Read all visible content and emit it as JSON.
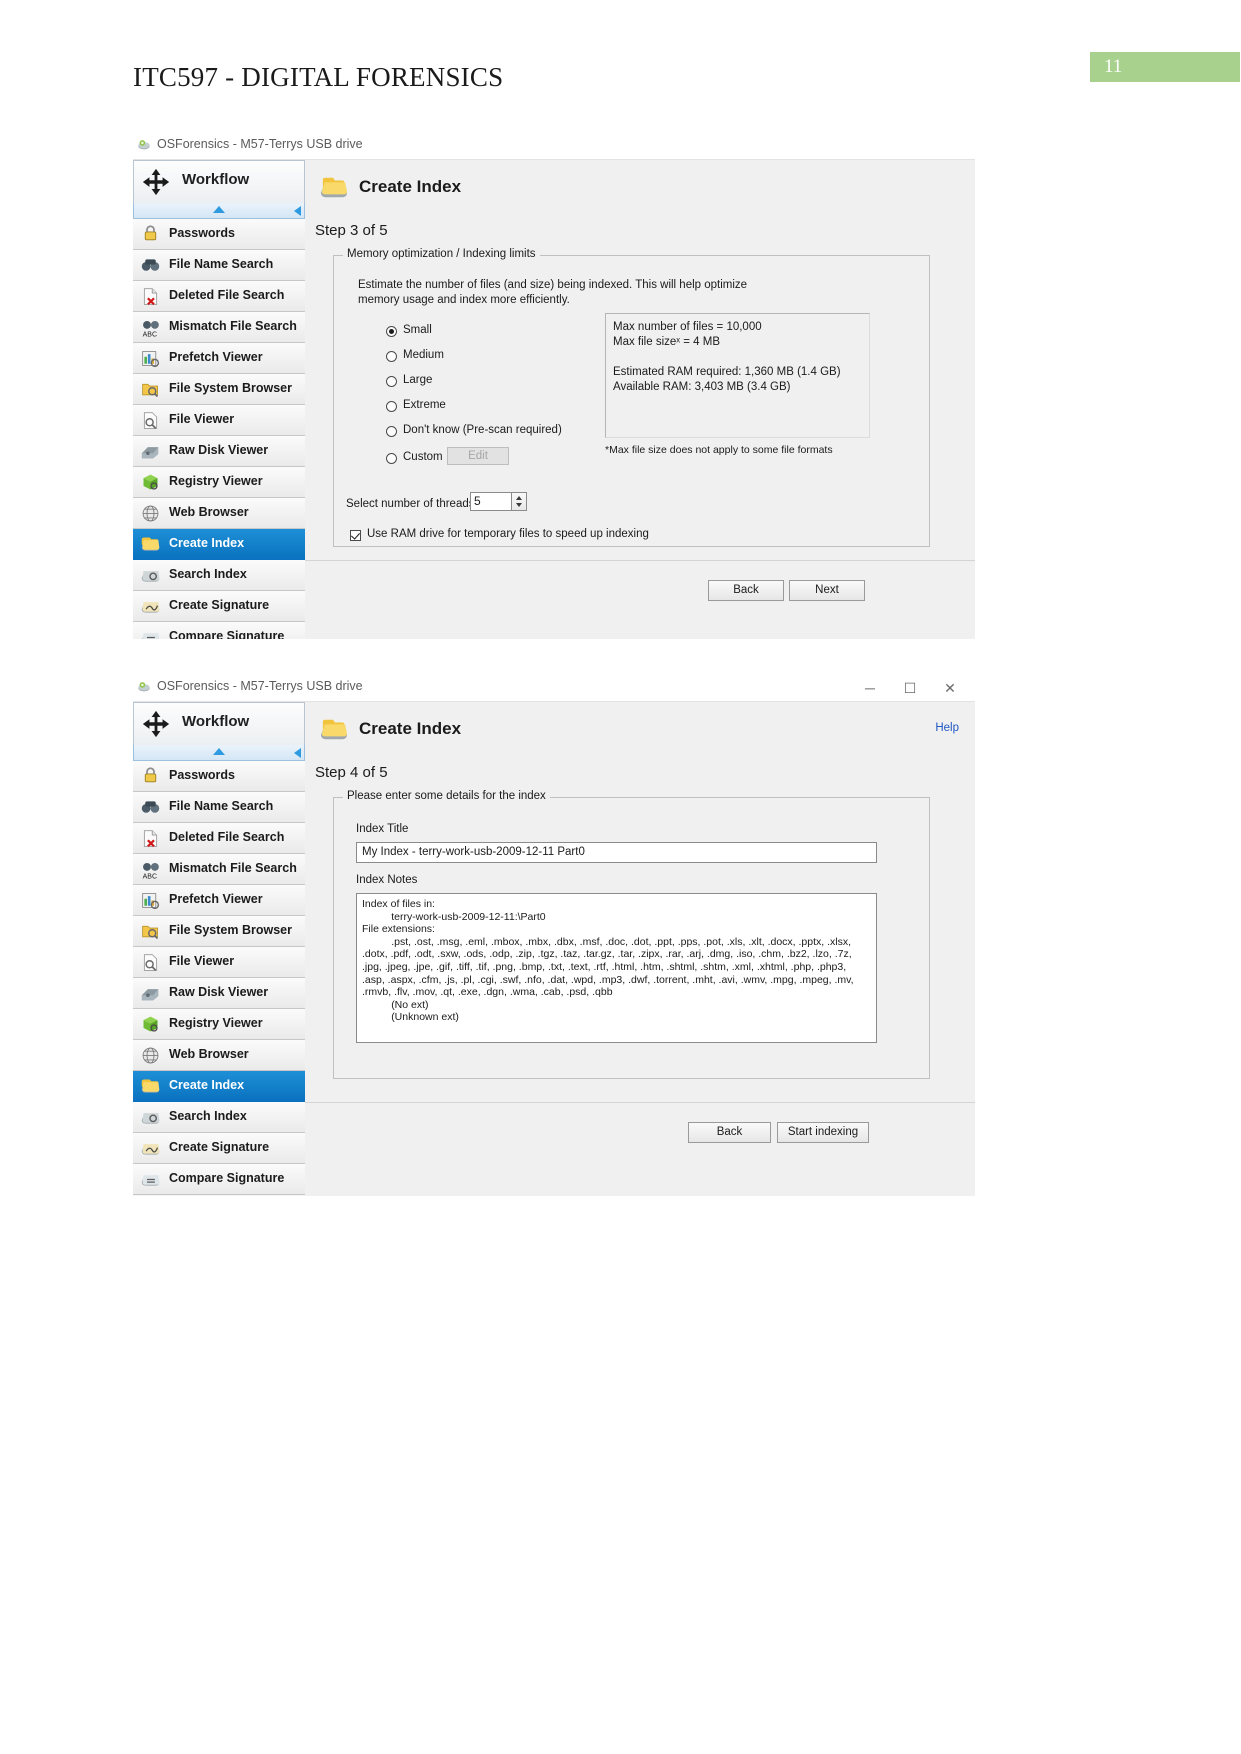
{
  "document": {
    "title": "ITC597 - DIGITAL FORENSICS",
    "page_number": "11",
    "badge_color": "#a9d18e"
  },
  "window1": {
    "titlebar": {
      "text": "OSForensics - M57-Terrys USB drive",
      "icon": "osforensics-icon"
    },
    "sidebar": {
      "header": {
        "label": "Workflow",
        "icon": "workflow-icon"
      },
      "items": [
        {
          "label": "Passwords",
          "icon": "padlock-icon",
          "selected": false
        },
        {
          "label": "File Name Search",
          "icon": "binoculars-icon",
          "selected": false
        },
        {
          "label": "Deleted File Search",
          "icon": "deleted-file-icon",
          "selected": false
        },
        {
          "label": "Mismatch File Search",
          "icon": "mismatch-abc-icon",
          "selected": false
        },
        {
          "label": "Prefetch Viewer",
          "icon": "prefetch-chart-icon",
          "selected": false
        },
        {
          "label": "File System Browser",
          "icon": "folder-search-icon",
          "selected": false
        },
        {
          "label": "File Viewer",
          "icon": "document-magnifier-icon",
          "selected": false
        },
        {
          "label": "Raw Disk Viewer",
          "icon": "raw-disk-icon",
          "selected": false
        },
        {
          "label": "Registry Viewer",
          "icon": "registry-cube-icon",
          "selected": false
        },
        {
          "label": "Web Browser",
          "icon": "web-globe-icon",
          "selected": false
        },
        {
          "label": "Create Index",
          "icon": "create-index-icon",
          "selected": true
        },
        {
          "label": "Search Index",
          "icon": "search-index-icon",
          "selected": false
        },
        {
          "label": "Create Signature",
          "icon": "create-signature-icon",
          "selected": false
        },
        {
          "label": "Compare Signature",
          "icon": "compare-signature-icon",
          "selected": false
        }
      ]
    },
    "pane": {
      "title": "Create Index",
      "title_icon": "create-index-icon",
      "step": "Step 3 of 5",
      "group_legend": "Memory optimization / Indexing limits",
      "description": "Estimate the number of files (and size) being indexed. This will help\noptimize memory usage and index more efficiently.",
      "radios": [
        {
          "label": "Small",
          "checked": true
        },
        {
          "label": "Medium",
          "checked": false
        },
        {
          "label": "Large",
          "checked": false
        },
        {
          "label": "Extreme",
          "checked": false
        },
        {
          "label": "Don't know (Pre-scan required)",
          "checked": false
        },
        {
          "label": "Custom",
          "checked": false
        }
      ],
      "edit_button": "Edit",
      "info_box": "Max number of files = 10,000\nMax file sizeˣ = 4 MB\n\nEstimated RAM required: 1,360 MB (1.4 GB)\nAvailable RAM: 3,403 MB (3.4 GB)",
      "footnote": "*Max file size does not apply to some file formats",
      "threads_label": "Select number of threads:",
      "threads_value": "5",
      "ramdrive_label": "Use RAM drive for temporary files to speed up indexing",
      "ramdrive_checked": true,
      "back_button": "Back",
      "next_button": "Next"
    }
  },
  "window2": {
    "titlebar": {
      "text": "OSForensics - M57-Terrys USB drive",
      "icon": "osforensics-icon",
      "minimize": "─",
      "maximize": "☐",
      "close": "✕"
    },
    "sidebar": {
      "header": {
        "label": "Workflow",
        "icon": "workflow-icon"
      },
      "items": [
        {
          "label": "Passwords",
          "icon": "padlock-icon",
          "selected": false
        },
        {
          "label": "File Name Search",
          "icon": "binoculars-icon",
          "selected": false
        },
        {
          "label": "Deleted File Search",
          "icon": "deleted-file-icon",
          "selected": false
        },
        {
          "label": "Mismatch File Search",
          "icon": "mismatch-abc-icon",
          "selected": false
        },
        {
          "label": "Prefetch Viewer",
          "icon": "prefetch-chart-icon",
          "selected": false
        },
        {
          "label": "File System Browser",
          "icon": "folder-search-icon",
          "selected": false
        },
        {
          "label": "File Viewer",
          "icon": "document-magnifier-icon",
          "selected": false
        },
        {
          "label": "Raw Disk Viewer",
          "icon": "raw-disk-icon",
          "selected": false
        },
        {
          "label": "Registry Viewer",
          "icon": "registry-cube-icon",
          "selected": false
        },
        {
          "label": "Web Browser",
          "icon": "web-globe-icon",
          "selected": false
        },
        {
          "label": "Create Index",
          "icon": "create-index-icon",
          "selected": true
        },
        {
          "label": "Search Index",
          "icon": "search-index-icon",
          "selected": false
        },
        {
          "label": "Create Signature",
          "icon": "create-signature-icon",
          "selected": false
        },
        {
          "label": "Compare Signature",
          "icon": "compare-signature-icon",
          "selected": false
        }
      ]
    },
    "pane": {
      "title": "Create Index",
      "title_icon": "create-index-icon",
      "help_link": "Help",
      "step": "Step 4 of 5",
      "group_legend": "Please enter some details for the index",
      "index_title_label": "Index Title",
      "index_title_value": "My Index - terry-work-usb-2009-12-11  Part0",
      "index_notes_label": "Index Notes",
      "index_notes_value": "Index of files in:\n          terry-work-usb-2009-12-11:\\Part0\nFile extensions:\n          .pst, .ost, .msg, .eml, .mbox, .mbx, .dbx, .msf, .doc, .dot, .ppt, .pps, .pot, .xls, .xlt, .docx, .pptx, .xlsx, .dotx, .pdf, .odt, .sxw, .ods, .odp, .zip, .tgz, .taz, .tar.gz, .tar, .zipx, .rar, .arj, .dmg, .iso, .chm, .bz2, .lzo, .7z, .jpg, .jpeg, .jpe, .gif, .tiff, .tif, .png, .bmp, .txt, .text, .rtf, .html, .htm, .shtml, .shtm, .xml, .xhtml, .php, .php3, .asp, .aspx, .cfm, .js, .pl, .cgi, .swf, .nfo, .dat, .wpd, .mp3, .dwf, .torrent, .mht, .avi, .wmv, .mpg, .mpeg, .mv, .rmvb, .flv, .mov, .qt, .exe, .dgn, .wma, .cab, .psd, .qbb\n          (No ext)\n          (Unknown ext)",
      "back_button": "Back",
      "start_button": "Start indexing"
    }
  }
}
